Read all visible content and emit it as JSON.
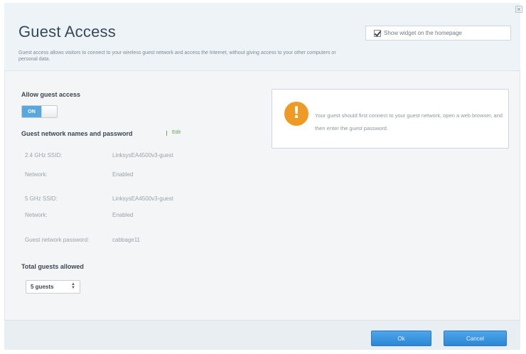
{
  "header": {
    "title": "Guest Access",
    "description": "Guest access allows visitors to connect to your wireless guest network and access the Internet, without giving access to your other computers or personal data.",
    "widget_label": "Show widget on the homepage",
    "widget_checked": true
  },
  "allow_guest": {
    "label": "Allow guest access",
    "toggle_state": "ON"
  },
  "network_names": {
    "label": "Guest network names and password",
    "edit_label": "Edit",
    "fields": [
      {
        "label": "2.4 GHz SSID:",
        "value": "LinksysEA4500v3-guest"
      },
      {
        "label": "Network:",
        "value": "Enabled"
      },
      {
        "label": "5 GHz SSID:",
        "value": "LinksysEA4500v3-guest"
      },
      {
        "label": "Network:",
        "value": "Enabled"
      },
      {
        "label": "Guest network password:",
        "value": "cabbage11"
      }
    ]
  },
  "total_guests": {
    "label": "Total guests allowed",
    "selected": "5 guests"
  },
  "info": {
    "icon": "warning-icon",
    "text": "Your guest should first connect to your guest network, open a web browser, and then enter the guest password."
  },
  "footer": {
    "ok_label": "Ok",
    "cancel_label": "Cancel"
  },
  "colors": {
    "accent_blue": "#3a93dd",
    "toggle_on": "#58a7df",
    "warning_orange": "#f09a26",
    "edit_green": "#63a744"
  }
}
